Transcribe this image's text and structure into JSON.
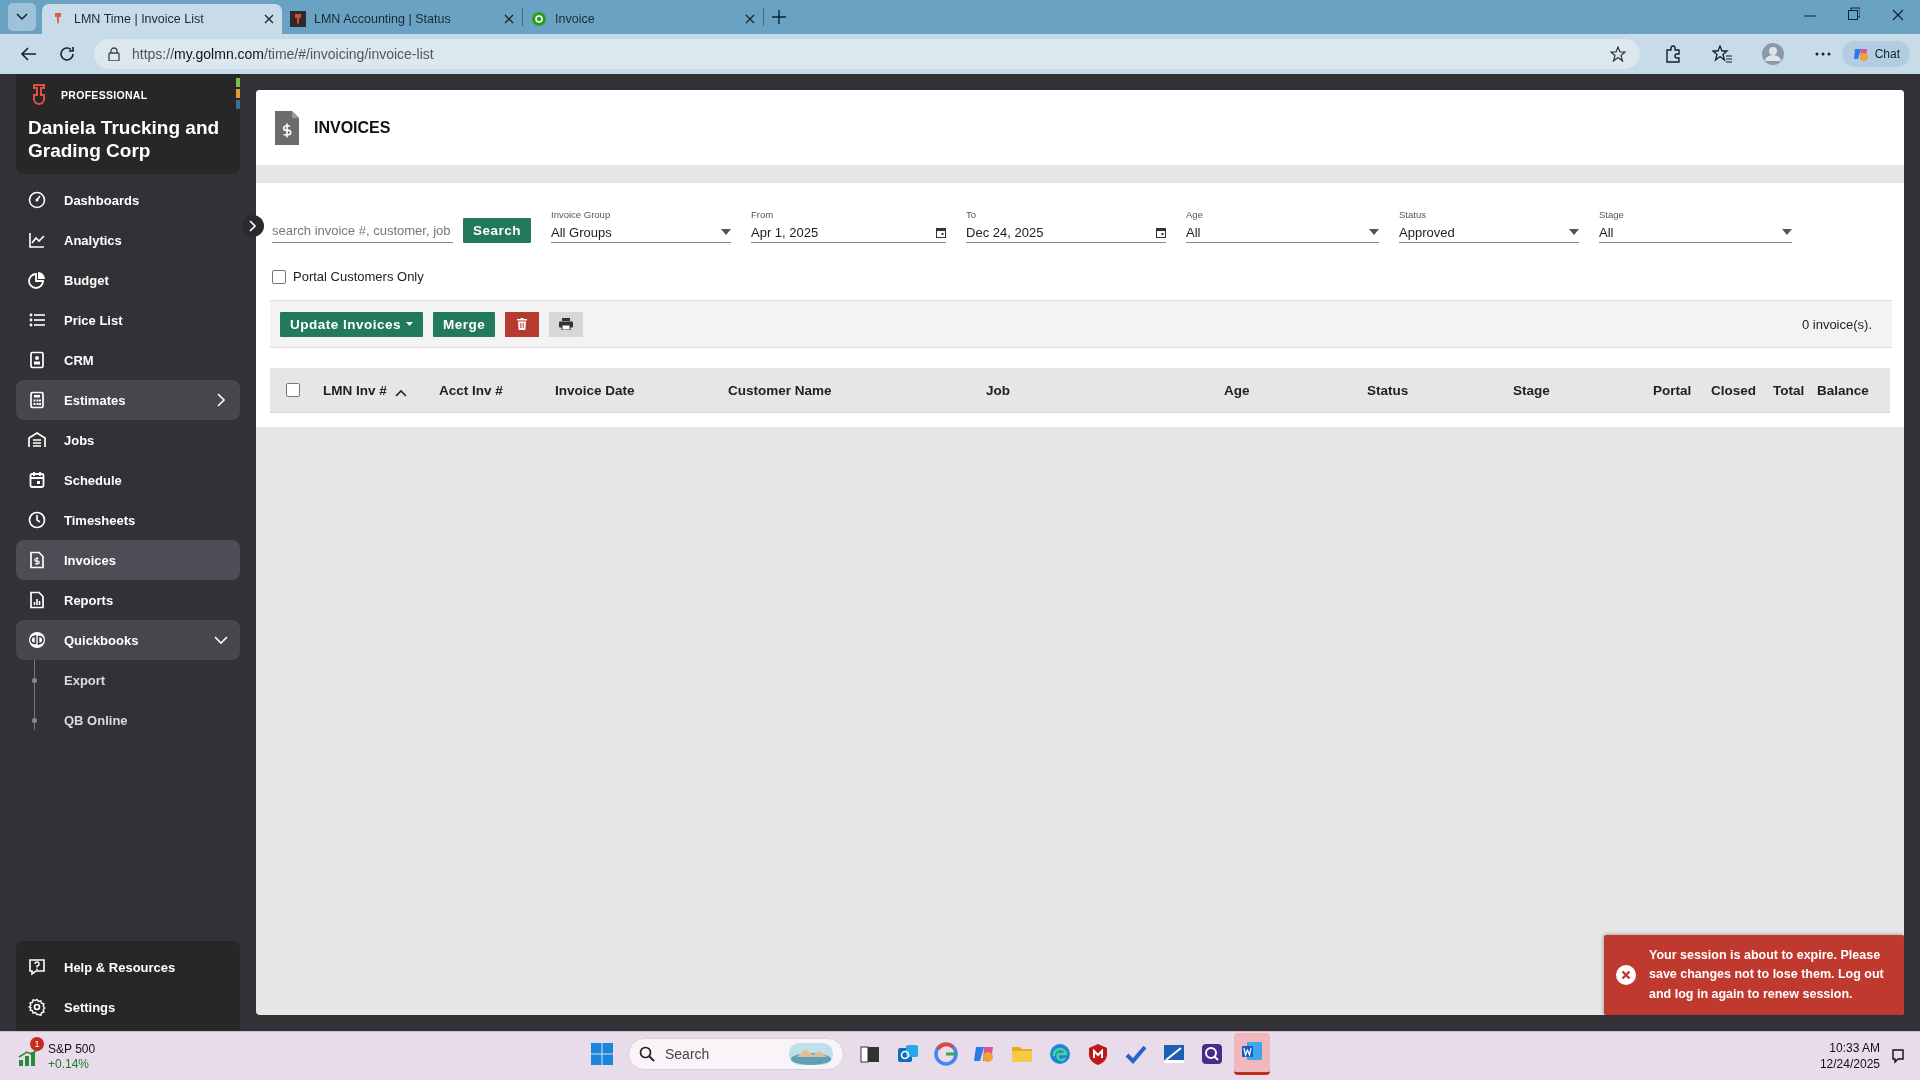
{
  "browser": {
    "tabs": [
      {
        "title": "LMN Time | Invoice List",
        "selected": true
      },
      {
        "title": "LMN Accounting | Status",
        "selected": false
      },
      {
        "title": "Invoice",
        "selected": false
      }
    ],
    "url_host": "https://my.golmn.com",
    "url_path": "/time/#/invoicing/invoice-list",
    "chat_label": "Chat"
  },
  "sidebar": {
    "plan": "PROFESSIONAL",
    "company": "Daniela Trucking and Grading Corp",
    "items": [
      {
        "label": "Dashboards",
        "selected": false
      },
      {
        "label": "Analytics",
        "selected": false
      },
      {
        "label": "Budget",
        "selected": false
      },
      {
        "label": "Price List",
        "selected": false
      },
      {
        "label": "CRM",
        "selected": false
      },
      {
        "label": "Estimates",
        "selected": false,
        "expanded": false
      },
      {
        "label": "Jobs",
        "selected": false
      },
      {
        "label": "Schedule",
        "selected": false
      },
      {
        "label": "Timesheets",
        "selected": false
      },
      {
        "label": "Invoices",
        "selected": true
      },
      {
        "label": "Reports",
        "selected": false
      },
      {
        "label": "Quickbooks",
        "selected": false,
        "expanded": true,
        "children": [
          {
            "label": "Export",
            "selected": false
          },
          {
            "label": "QB Online",
            "selected": false
          }
        ]
      }
    ],
    "bottom_items": [
      {
        "label": "Help & Resources"
      },
      {
        "label": "Settings"
      }
    ]
  },
  "page": {
    "title": "INVOICES",
    "search": {
      "placeholder": "search invoice #, customer, job",
      "button": "Search"
    },
    "filters": [
      {
        "kind": "select",
        "label": "Invoice Group",
        "value": "All Groups"
      },
      {
        "kind": "date",
        "label": "From",
        "value": "Apr 1, 2025"
      },
      {
        "kind": "date",
        "label": "To",
        "value": "Dec 24, 2025"
      },
      {
        "kind": "select",
        "label": "Age",
        "value": "All"
      },
      {
        "kind": "select",
        "label": "Status",
        "value": "Approved"
      },
      {
        "kind": "select",
        "label": "Stage",
        "value": "All"
      }
    ],
    "portal_only": {
      "label": "Portal Customers Only",
      "checked": false
    },
    "toolbar": [
      {
        "kind": "menu",
        "label": "Update Invoices"
      },
      {
        "kind": "text",
        "label": "Merge"
      },
      {
        "kind": "delete"
      },
      {
        "kind": "print"
      }
    ],
    "count": "0 invoice(s).",
    "table": {
      "select_all": false,
      "columns": [
        {
          "label": "LMN Inv #",
          "sorted": true
        },
        {
          "label": "Acct Inv #",
          "sorted": false
        },
        {
          "label": "Invoice Date",
          "sorted": false
        },
        {
          "label": "Customer Name",
          "sorted": false
        },
        {
          "label": "Job",
          "sorted": false
        },
        {
          "label": "Age",
          "sorted": false
        },
        {
          "label": "Status",
          "sorted": false
        },
        {
          "label": "Stage",
          "sorted": false
        },
        {
          "label": "Portal",
          "sorted": false
        },
        {
          "label": "Closed",
          "sorted": false
        },
        {
          "label": "Total",
          "sorted": false
        },
        {
          "label": "Balance",
          "sorted": false
        }
      ]
    }
  },
  "toast": {
    "message": "Your session is about to expire. Please save changes not to lose them. Log out and log in again to renew session."
  },
  "taskbar": {
    "widget_name": "S&P 500",
    "widget_change": "+0.14%",
    "widget_badge": "1",
    "search_placeholder": "Search",
    "time": "10:33 AM",
    "date": "12/24/2025"
  }
}
